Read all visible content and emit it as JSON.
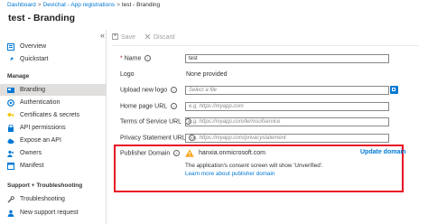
{
  "breadcrumb": {
    "items": [
      "Dashboard",
      "Devichat - App registrations",
      "test - Branding"
    ],
    "separator": ">"
  },
  "page_title": "test - Branding",
  "sidebar": {
    "collapse_icon": "«",
    "top_items": [
      {
        "label": "Overview",
        "icon": "overview-icon"
      },
      {
        "label": "Quickstart",
        "icon": "quickstart-icon"
      }
    ],
    "manage_heading": "Manage",
    "manage_items": [
      {
        "label": "Branding",
        "icon": "branding-icon",
        "selected": true
      },
      {
        "label": "Authentication",
        "icon": "authentication-icon"
      },
      {
        "label": "Certificates & secrets",
        "icon": "key-icon"
      },
      {
        "label": "API permissions",
        "icon": "api-permissions-icon"
      },
      {
        "label": "Expose an API",
        "icon": "cloud-icon"
      },
      {
        "label": "Owners",
        "icon": "owners-icon"
      },
      {
        "label": "Manifest",
        "icon": "manifest-icon"
      }
    ],
    "support_heading": "Support + Troubleshooting",
    "support_items": [
      {
        "label": "Troubleshooting",
        "icon": "wrench-icon"
      },
      {
        "label": "New support request",
        "icon": "person-support-icon"
      }
    ]
  },
  "toolbar": {
    "save_label": "Save",
    "discard_label": "Discard"
  },
  "form": {
    "name_label": "Name",
    "name_required": "*",
    "name_value": "test",
    "logo_label": "Logo",
    "logo_value": "None provided",
    "upload_label": "Upload new logo",
    "upload_placeholder": "Select a file",
    "homepage_label": "Home page URL",
    "homepage_placeholder": "e.g. https://myapp.com",
    "tos_label": "Terms of Service URL",
    "tos_placeholder": "e.g. https://myapp.com/termsofservice",
    "privacy_label": "Privacy Statement URL",
    "privacy_placeholder": "e.g. https://myapp.com/privacystatement",
    "publisher_label": "Publisher Domain",
    "publisher_value": "hanxia.onmicrosoft.com",
    "update_domain_label": "Update domain",
    "consent_note": "The application's consent screen will show 'Unverified'.",
    "learn_more_label": "Learn more about publisher domain",
    "info_glyph": "i"
  },
  "colors": {
    "accent": "#0078d4",
    "highlight_border": "#e81123",
    "warning": "#f7a41d",
    "selected_bg": "#e1dfdd"
  }
}
